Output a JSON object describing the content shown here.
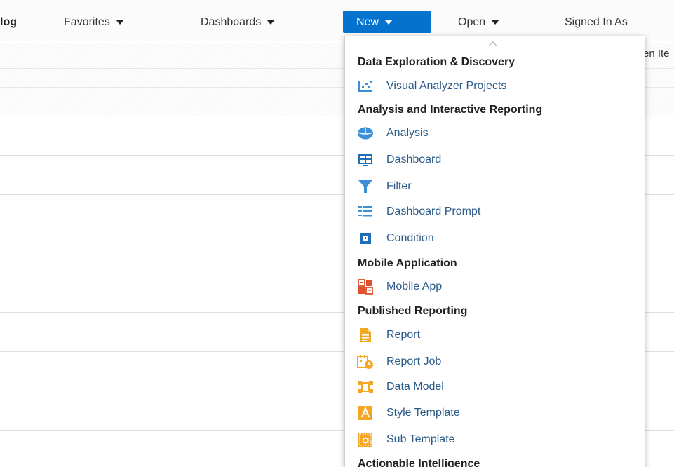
{
  "topnav": {
    "catalog_label": "log",
    "favorites_label": "Favorites",
    "dashboards_label": "Dashboards",
    "new_label": "New",
    "open_label": "Open",
    "signed_in_label": "Signed In As"
  },
  "background": {
    "toolbar_partial_text": "en Ite"
  },
  "menu": {
    "sections": {
      "data_exploration": "Data Exploration & Discovery",
      "analysis_reporting": "Analysis and Interactive Reporting",
      "mobile": "Mobile Application",
      "published": "Published Reporting",
      "actionable": "Actionable Intelligence"
    },
    "items": {
      "visual_analyzer": {
        "label": "Visual Analyzer Projects",
        "icon": "visual-analyzer-icon"
      },
      "analysis": {
        "label": "Analysis",
        "icon": "analysis-icon"
      },
      "dashboard": {
        "label": "Dashboard",
        "icon": "dashboard-icon"
      },
      "filter": {
        "label": "Filter",
        "icon": "filter-icon"
      },
      "dashboard_prompt": {
        "label": "Dashboard Prompt",
        "icon": "dashboard-prompt-icon"
      },
      "condition": {
        "label": "Condition",
        "icon": "condition-icon"
      },
      "mobile_app": {
        "label": "Mobile App",
        "icon": "mobile-app-icon"
      },
      "report": {
        "label": "Report",
        "icon": "report-icon"
      },
      "report_job": {
        "label": "Report Job",
        "icon": "report-job-icon"
      },
      "data_model": {
        "label": "Data Model",
        "icon": "data-model-icon"
      },
      "style_template": {
        "label": "Style Template",
        "icon": "style-template-icon"
      },
      "sub_template": {
        "label": "Sub Template",
        "icon": "sub-template-icon"
      }
    }
  },
  "colors": {
    "accent_blue": "#0572ce",
    "icon_blue": "#3a8fd8",
    "icon_red": "#e0502c",
    "icon_orange": "#f5a623",
    "item_text": "#2a5a8a"
  }
}
